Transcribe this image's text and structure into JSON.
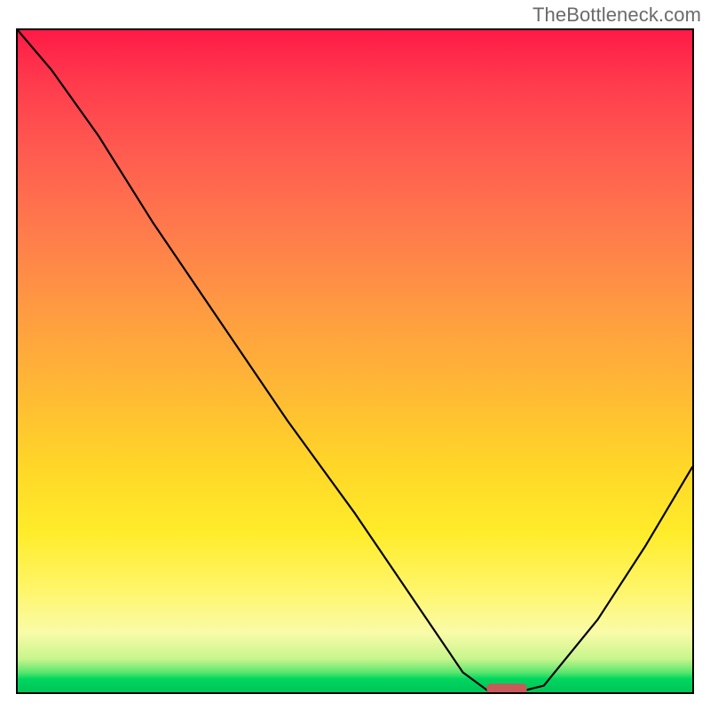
{
  "watermark": "TheBottleneck.com",
  "chart_data": {
    "type": "line",
    "title": "",
    "xlabel": "",
    "ylabel": "",
    "xlim": [
      0,
      1
    ],
    "ylim": [
      0,
      1
    ],
    "background_gradient_stops": [
      {
        "pos": 0.0,
        "color": "#ff1a47"
      },
      {
        "pos": 0.3,
        "color": "#ff7a4c"
      },
      {
        "pos": 0.55,
        "color": "#ffba34"
      },
      {
        "pos": 0.85,
        "color": "#fff66e"
      },
      {
        "pos": 0.97,
        "color": "#59e66e"
      },
      {
        "pos": 1.0,
        "color": "#00c558"
      }
    ],
    "series": [
      {
        "name": "bottleneck-curve",
        "x": [
          0.0,
          0.05,
          0.12,
          0.2,
          0.3,
          0.4,
          0.5,
          0.6,
          0.66,
          0.7,
          0.74,
          0.78,
          0.86,
          0.93,
          1.0
        ],
        "y": [
          1.0,
          0.94,
          0.84,
          0.71,
          0.56,
          0.41,
          0.27,
          0.12,
          0.03,
          0.0,
          0.0,
          0.01,
          0.11,
          0.22,
          0.34
        ]
      }
    ],
    "marker": {
      "name": "sweet-spot-marker",
      "x_start": 0.695,
      "x_end": 0.755,
      "y": 0.003,
      "color": "#c85a5a"
    }
  }
}
